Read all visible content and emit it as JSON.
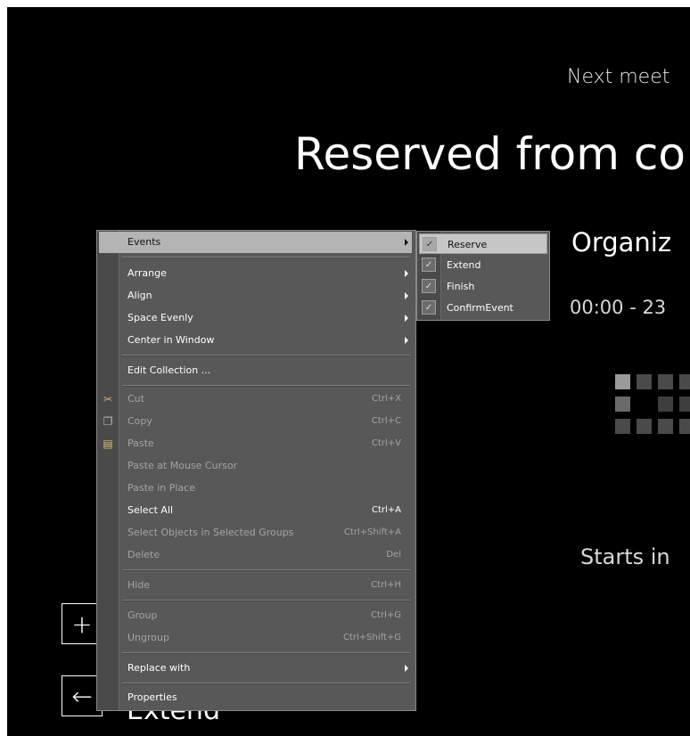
{
  "display": {
    "next_meeting": "Next meet",
    "title": "Reserved from co",
    "organizer": "Organiz",
    "time_range": "00:00 - 23",
    "starts_in": "Starts in",
    "extend_label": "Extend",
    "add_icon": "+",
    "back_icon": "←"
  },
  "context_menu": {
    "events": "Events",
    "arrange": "Arrange",
    "align": "Align",
    "space_evenly": "Space Evenly",
    "center_in_window": "Center in Window",
    "edit_collection": "Edit Collection ...",
    "cut": {
      "label": "Cut",
      "shortcut": "Ctrl+X"
    },
    "copy": {
      "label": "Copy",
      "shortcut": "Ctrl+C"
    },
    "paste": {
      "label": "Paste",
      "shortcut": "Ctrl+V"
    },
    "paste_at_cursor": "Paste at Mouse Cursor",
    "paste_in_place": "Paste in Place",
    "select_all": {
      "label": "Select All",
      "shortcut": "Ctrl+A"
    },
    "select_in_groups": {
      "label": "Select Objects in Selected Groups",
      "shortcut": "Ctrl+Shift+A"
    },
    "delete": {
      "label": "Delete",
      "shortcut": "Del"
    },
    "hide": {
      "label": "Hide",
      "shortcut": "Ctrl+H"
    },
    "group": {
      "label": "Group",
      "shortcut": "Ctrl+G"
    },
    "ungroup": {
      "label": "Ungroup",
      "shortcut": "Ctrl+Shift+G"
    },
    "replace_with": "Replace with",
    "properties": "Properties"
  },
  "events_submenu": {
    "items": [
      {
        "label": "Reserve",
        "checked": true
      },
      {
        "label": "Extend",
        "checked": true
      },
      {
        "label": "Finish",
        "checked": true
      },
      {
        "label": "ConfirmEvent",
        "checked": true
      }
    ],
    "check_glyph": "✓"
  },
  "icons": {
    "cut": "scissors-icon",
    "copy": "copy-icon",
    "paste": "paste-icon"
  },
  "colors": {
    "background": "#000000",
    "menu_bg": "#585858",
    "highlight": "#b4b4b4",
    "disabled_text": "#a4a4a4"
  }
}
